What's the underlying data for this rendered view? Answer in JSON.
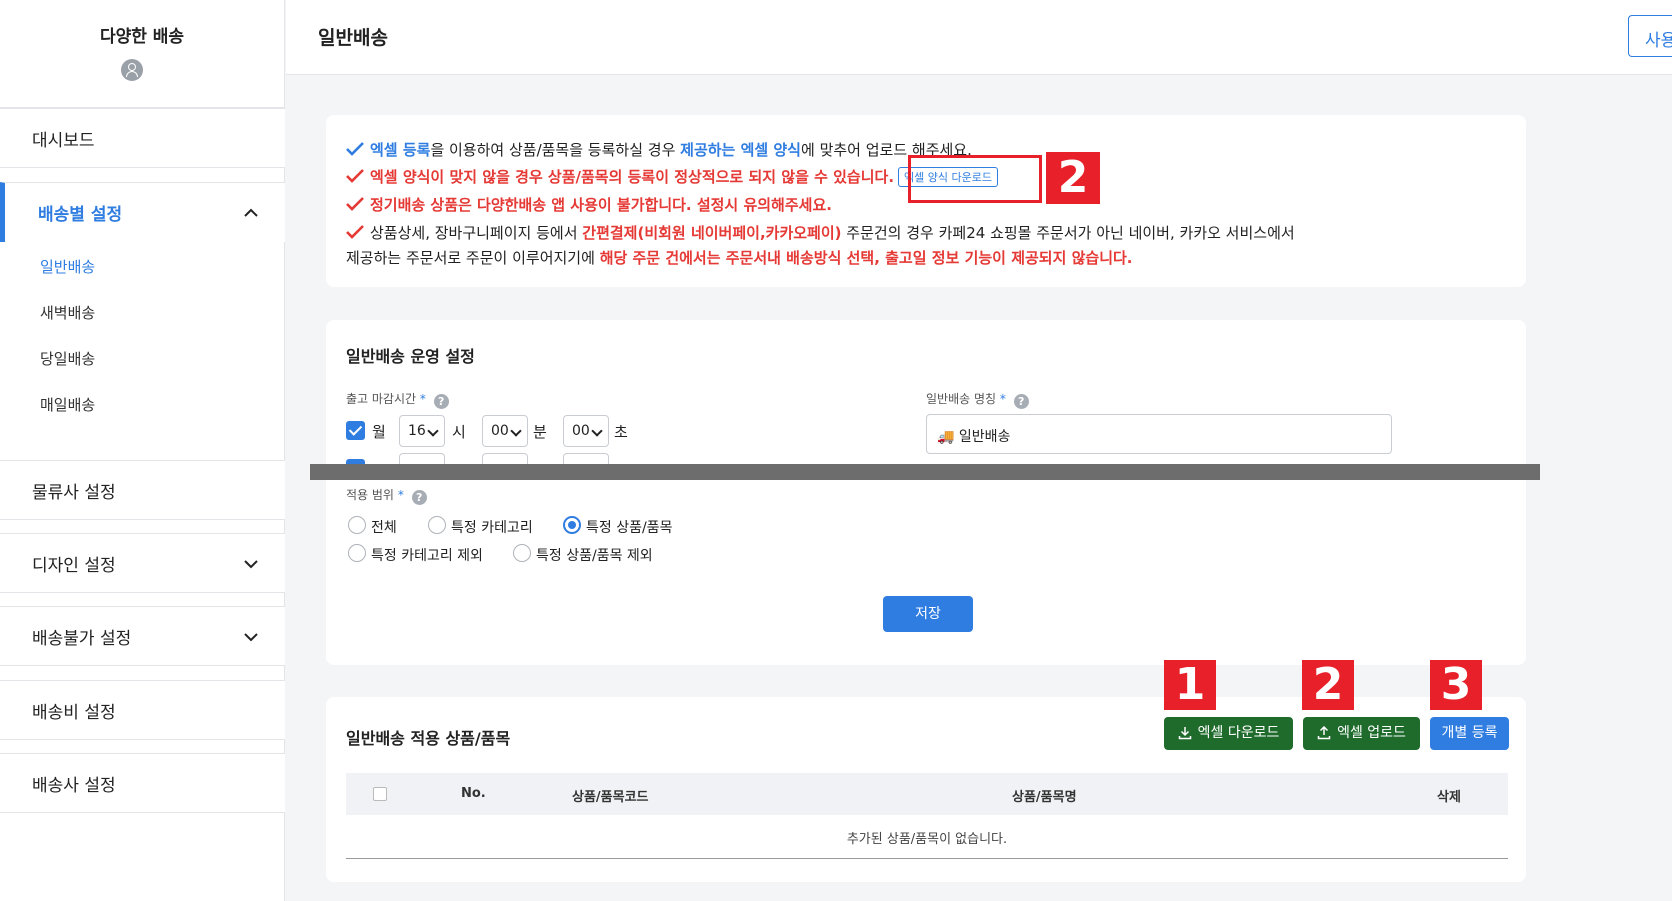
{
  "sidebar": {
    "brand": "다양한 배송",
    "items": [
      {
        "label": "대시보드"
      },
      {
        "label": "배송별 설정"
      },
      {
        "label": "물류사 설정"
      },
      {
        "label": "디자인 설정"
      },
      {
        "label": "배송불가 설정"
      },
      {
        "label": "배송비 설정"
      },
      {
        "label": "배송사 설정"
      }
    ],
    "sub_items": [
      {
        "label": "일반배송"
      },
      {
        "label": "새벽배송"
      },
      {
        "label": "당일배송"
      },
      {
        "label": "매일배송"
      }
    ]
  },
  "header": {
    "title": "일반배송",
    "user_button": "사용"
  },
  "notice": {
    "line1_a": "엑셀 등록",
    "line1_b": "을 이용하여 상품/품목을 등록하실 경우 ",
    "line1_c": "제공하는 엑셀 양식",
    "line1_d": "에 맞추어 업로드 해주세요.",
    "line2": "엑셀 양식이 맞지 않을 경우 상품/품목의 등록이 정상적으로 되지 않을 수 있습니다.",
    "line2_button": "엑셀 양식 다운로드",
    "line3": "정기배송 상품은 다양한배송 앱 사용이 불가합니다. 설정시 유의해주세요.",
    "line4_a": "상품상세, 장바구니페이지 등에서 ",
    "line4_b": "간편결제(비회원 네이버페이,카카오페이)",
    "line4_c": " 주문건의 경우 카페24 쇼핑몰 주문서가 아닌 네이버, 카카오 서비스에서",
    "line5_a": "제공하는 주문서로 주문이 이루어지기에 ",
    "line5_b": "해당 주문 건에서는 주문서내 배송방식 선택, 출고일 정보 기능이 제공되지 않습니다."
  },
  "callouts": {
    "notice_badge": "2",
    "badge1": "1",
    "badge2": "2",
    "badge3": "3"
  },
  "settings": {
    "title": "일반배송 운영 설정",
    "cutoff_label": "출고 마감시간",
    "required_mark": "*",
    "help": "?",
    "day": "월",
    "hour": "16",
    "hour_unit": "시",
    "minute": "00",
    "minute_unit": "분",
    "second": "00",
    "second_unit": "초",
    "name_label": "일반배송 명칭",
    "name_value": "🚚 일반배송",
    "scope_label": "적용 범위",
    "scope_options": [
      {
        "label": "전체",
        "selected": false
      },
      {
        "label": "특정 카테고리",
        "selected": false
      },
      {
        "label": "특정 상품/품목",
        "selected": true
      },
      {
        "label": "특정 카테고리 제외",
        "selected": false
      },
      {
        "label": "특정 상품/품목 제외",
        "selected": false
      }
    ],
    "save_button": "저장"
  },
  "products": {
    "title": "일반배송 적용 상품/품목",
    "excel_download": "엑셀 다운로드",
    "excel_upload": "엑셀 업로드",
    "individual_register": "개별 등록",
    "columns": [
      "No.",
      "상품/품목코드",
      "상품/품목명",
      "삭제"
    ],
    "empty_message": "추가된 상품/품목이 없습니다."
  },
  "colors": {
    "accent": "#2f7de1",
    "warning": "#e53935",
    "excel_green": "#1e6b2c",
    "callout_red": "#e8202a"
  }
}
